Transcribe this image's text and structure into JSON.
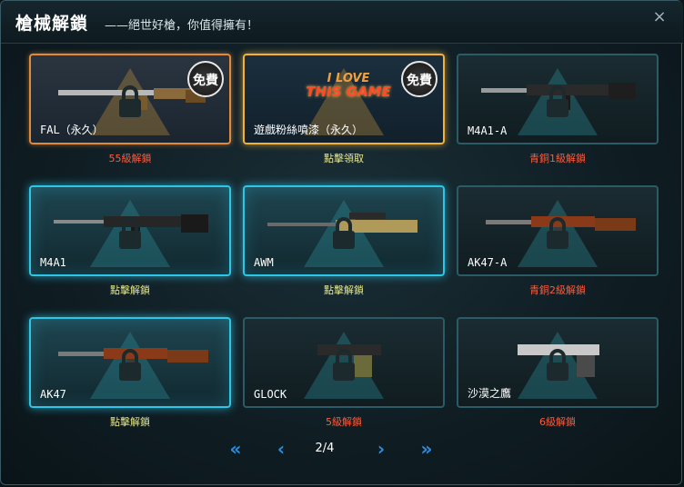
{
  "header": {
    "title": "槍械解鎖",
    "subtitle": "——絕世好槍，你值得擁有！",
    "close_glyph": "×"
  },
  "cards": [
    {
      "label": "FAL（永久）",
      "status": "55級解鎖",
      "badge": "免費",
      "style": "orange"
    },
    {
      "label": "遊戲粉絲噴漆（永久）",
      "status": "點擊領取",
      "badge": "免費",
      "banner_line1": "I LOVE",
      "banner_line2": "THIS GAME",
      "style": "gold"
    },
    {
      "label": "M4A1-A",
      "status": "青銅1級解鎖",
      "style": "normal"
    },
    {
      "label": "M4A1",
      "status": "點擊解鎖",
      "style": "hl"
    },
    {
      "label": "AWM",
      "status": "點擊解鎖",
      "style": "hl"
    },
    {
      "label": "AK47-A",
      "status": "青銅2級解鎖",
      "style": "normal"
    },
    {
      "label": "AK47",
      "status": "點擊解鎖",
      "style": "hl"
    },
    {
      "label": "GLOCK",
      "status": "5級解鎖",
      "style": "normal"
    },
    {
      "label": "沙漠之鷹",
      "status": "6級解鎖",
      "style": "normal"
    }
  ],
  "pager": {
    "first_glyph": "«",
    "prev_glyph": "‹",
    "page": "2/4",
    "next_glyph": "›",
    "last_glyph": "»"
  },
  "colors": {
    "accent_cyan": "#2ec6e6",
    "status_red": "#ff5a3a",
    "status_yellow": "#e6e88a",
    "pager_blue": "#2a8ee0"
  }
}
